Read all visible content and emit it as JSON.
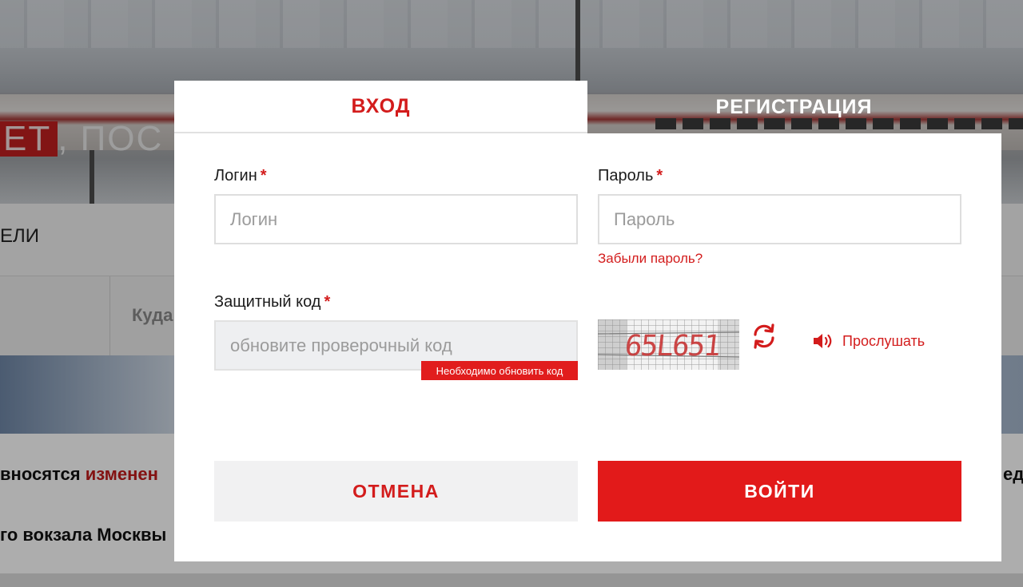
{
  "background_page": {
    "banner_highlight": "ЕТ",
    "banner_text": ", ПОС",
    "nav_text": "ЕЛИ",
    "form_field_placeholder": "Куда",
    "news": [
      {
        "prefix": "вносятся ",
        "highlight": "изменен"
      },
      {
        "text": "го вокзала Москвы"
      }
    ],
    "news_right_fragment": "ед"
  },
  "tabs": {
    "login_label": "ВХОД",
    "register_label": "РЕГИСТРАЦИЯ",
    "active": "login"
  },
  "form": {
    "login": {
      "label": "Логин",
      "required_mark": "*",
      "placeholder": "Логин",
      "value": ""
    },
    "password": {
      "label": "Пароль",
      "required_mark": "*",
      "placeholder": "Пароль",
      "value": "",
      "forgot_link": "Забыли пароль?"
    },
    "security_code": {
      "label": "Защитный код",
      "required_mark": "*",
      "placeholder": "обновите проверочный код",
      "error": "Необходимо обновить код",
      "captcha_text": "65L651",
      "listen_label": "Прослушать"
    }
  },
  "buttons": {
    "cancel_label": "ОТМЕНА",
    "submit_label": "ВОЙТИ"
  },
  "colors": {
    "accent": "#d31c1c",
    "button_red": "#e21a1a",
    "cancel_bg": "#f1f1f2",
    "disabled_input_bg": "#eeeff1"
  },
  "icons": [
    "refresh-icon",
    "speaker-icon"
  ]
}
